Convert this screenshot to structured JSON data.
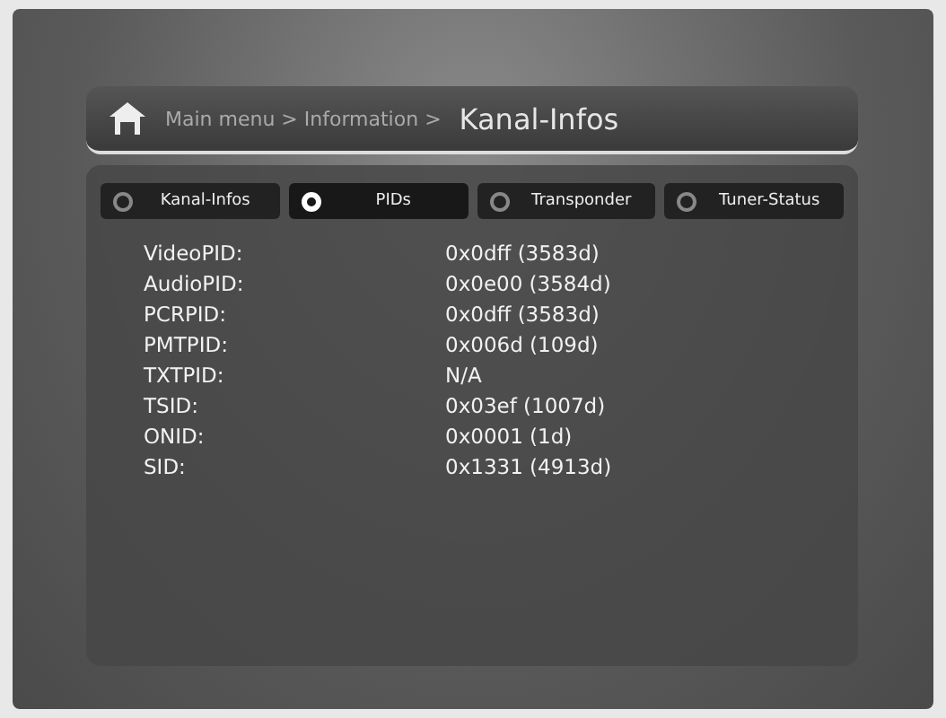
{
  "header": {
    "breadcrumb": "Main menu > Information >",
    "title": "Kanal-Infos"
  },
  "tabs": [
    {
      "label": "Kanal-Infos",
      "selected": false
    },
    {
      "label": "PIDs",
      "selected": true
    },
    {
      "label": "Transponder",
      "selected": false
    },
    {
      "label": "Tuner-Status",
      "selected": false
    }
  ],
  "rows": [
    {
      "label": "VideoPID:",
      "value": "0x0dff (3583d)"
    },
    {
      "label": "AudioPID:",
      "value": "0x0e00 (3584d)"
    },
    {
      "label": "PCRPID:",
      "value": "0x0dff (3583d)"
    },
    {
      "label": "PMTPID:",
      "value": "0x006d (109d)"
    },
    {
      "label": "TXTPID:",
      "value": "N/A"
    },
    {
      "label": "TSID:",
      "value": "0x03ef (1007d)"
    },
    {
      "label": "ONID:",
      "value": "0x0001 (1d)"
    },
    {
      "label": "SID:",
      "value": "0x1331 (4913d)"
    }
  ]
}
